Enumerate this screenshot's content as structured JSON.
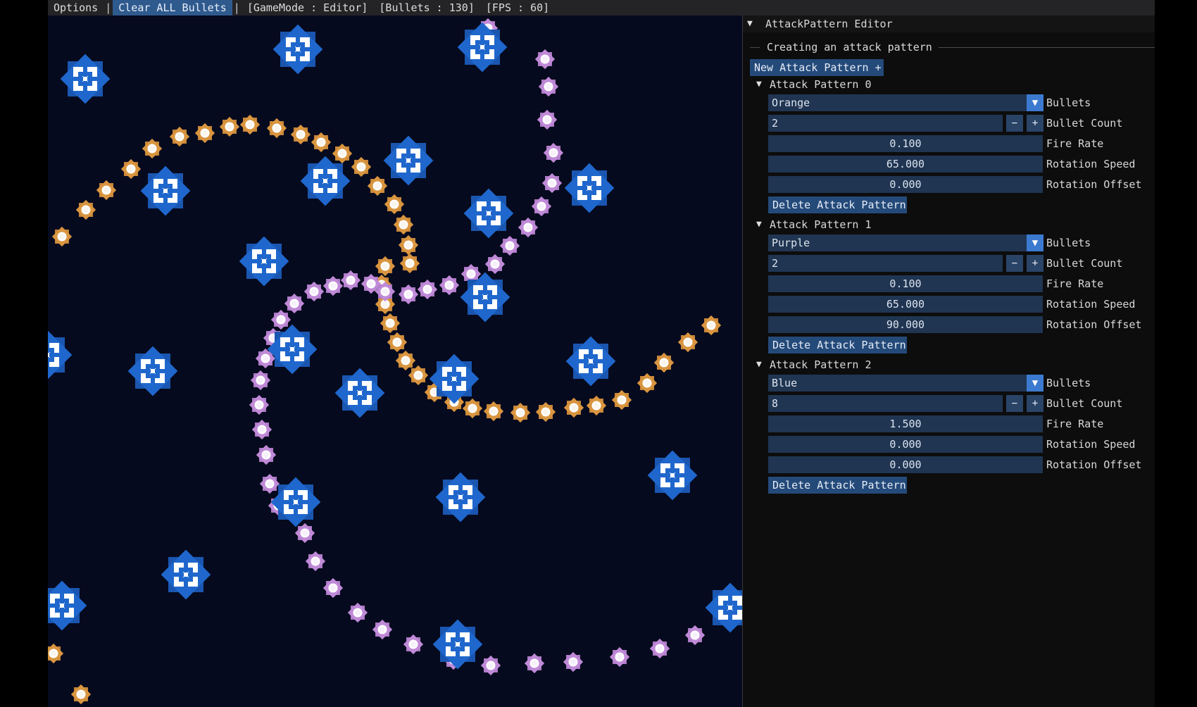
{
  "menubar": {
    "options": "Options",
    "sep1": "|",
    "clear_all": "Clear ALL Bullets",
    "sep2": "|",
    "gamemode": "[GameMode : Editor]",
    "bullets": "[Bullets : 130]",
    "fps": "[FPS : 60]"
  },
  "colors": {
    "game_bg": "#060a1e",
    "orange_bullet": "#d9953f",
    "purple_bullet": "#c08ad8",
    "blue_bullet": "#1e62c4",
    "accent": "#2f5a8e"
  },
  "panel": {
    "title": "AttackPattern Editor",
    "section_label": "Creating an attack pattern",
    "new_button": "New Attack Pattern +",
    "labels": {
      "bullets": "Bullets",
      "bullet_count": "Bullet Count",
      "fire_rate": "Fire Rate",
      "rotation_speed": "Rotation Speed",
      "rotation_offset": "Rotation Offset",
      "minus": "−",
      "plus": "+",
      "combo_arrow": "▼",
      "delete": "Delete Attack Pattern"
    },
    "patterns": [
      {
        "header": "Attack Pattern 0",
        "bullets": "Orange",
        "bullet_count": "2",
        "fire_rate": "0.100",
        "rotation_speed": "65.000",
        "rotation_offset": "0.000"
      },
      {
        "header": "Attack Pattern 1",
        "bullets": "Purple",
        "bullet_count": "2",
        "fire_rate": "0.100",
        "rotation_speed": "65.000",
        "rotation_offset": "90.000"
      },
      {
        "header": "Attack Pattern 2",
        "bullets": "Blue",
        "bullet_count": "8",
        "fire_rate": "1.500",
        "rotation_speed": "0.000",
        "rotation_offset": "0.000"
      }
    ]
  }
}
